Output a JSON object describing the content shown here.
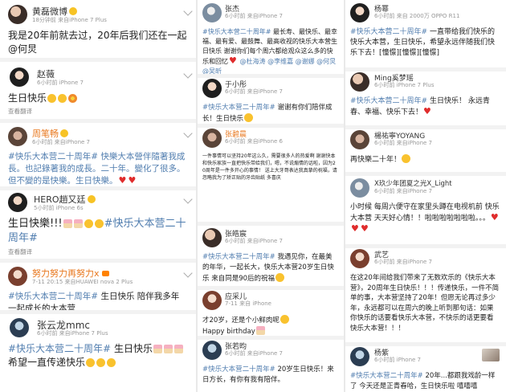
{
  "col1": {
    "posts": [
      {
        "name": "黄磊微博",
        "meta": "18分钟前  来自iPhone 7 Plus",
        "text": "我是20年前就去过，20年后我们还在一起 @何炅"
      },
      {
        "name": "赵薇",
        "meta": "6小时前    iPhone 7",
        "text": "生日快乐",
        "foot": "查看翻译"
      },
      {
        "name": "周笔畅",
        "meta": "6小时前  来自iPhone 7",
        "text": "#快乐大本营二十周年# 快樂大本營伴隨著我成長。也記錄著我的成長。二十年。變化了很多。但不變的是快樂。生日快樂。"
      },
      {
        "name": "HERO趙又廷",
        "meta": "5小时前    iPhone 6s",
        "text": "生日快樂!!!",
        "tag": "#快乐大本营二十周年#",
        "foot": "查看翻译"
      },
      {
        "name": "努力努力再努力x",
        "meta": "7-11 20:15  来自HUAWEI nova 2 Plus",
        "text_pre": "#快乐大本营二十周年#",
        "text": " 生日快乐 陪伴我多年 一起成长的大本营"
      },
      {
        "name": "张云龙mmc",
        "meta": "6小时前  来自iPhone 7 Plus",
        "tag": "#快乐大本营二十周年#",
        "text": " 生日快乐",
        "text2": "希望一直传递快乐"
      }
    ]
  },
  "col2": {
    "posts": [
      {
        "name": "张杰",
        "meta": "6小时前  来自iPhone 7",
        "tag": "#快乐大本营二十周年#",
        "text": " 最长寿、最快乐、最幸福、最有爱、最鼓舞、最高收视的快乐大本营生日快乐 谢谢你们每个周六都给观众这么多的快乐和回忆",
        "mentions": "@杜海涛 @李维嘉 @谢娜 @何炅 @吴昕"
      },
      {
        "name": "于小彤",
        "meta": "6小时前  来自iPhone 7",
        "tag": "#快乐大本营二十周年#",
        "text": " 谢谢有你们陪伴成长！生日快乐"
      },
      {
        "name": "张碧晨",
        "meta": "6小时前  来自iPhone 6",
        "text": "一件事情可以坚持20年这么久，需要很多人的热爱啊 谢谢快本和快乐家族一直把快乐带给我们，嗯，不说煽情的话啦，因为20周年是一件多开心的事情！ 送上大牙哥表达我真挚的祝福，请忽略我为了矫正贴的牙齿贴纸 多喜庆"
      },
      {
        "name": "张皓宸",
        "meta": "6小时前  来自iPhone 7",
        "tag": "#快乐大本营二十周年#",
        "text": " 我遇见你，在最美的年华，一起长大，快乐大本营20岁生日快乐 来自同是90后的祝福"
      },
      {
        "name": "应采儿",
        "meta": "7-11 来自 iPhone",
        "text": "才20岁，还是个小鲜肉呢",
        "text2": "Happy birthday"
      },
      {
        "name": "张若昀",
        "meta": "6小时前  来自iPhone 7",
        "tag": "#快乐大本营二十周年#",
        "text": " 20岁生日快乐！来日方长，有你有我有陪伴。"
      }
    ]
  },
  "col3": {
    "posts": [
      {
        "name": "杨幂",
        "meta": "6小时前  来自 2000万 OPPO R11",
        "tag": "#快乐大本营二十周年#",
        "text": " 一直带给我们快乐的快乐大本营，生日快乐，希望永远伴随我们快乐下去！[憧憬][憧憬][憧憬]"
      },
      {
        "name": "Ming",
        "name2": "奚梦瑶",
        "meta": "6小时前    iPhone 7 Plus",
        "tag": "#快乐大本营二十周年#",
        "text": " 生日快乐！ 永远青春、幸福、快乐下去！"
      },
      {
        "name": "楊祐寧YOYANG",
        "meta": "6小时前  来自iPhone 7",
        "text": "再快樂二十年！"
      },
      {
        "name": "X玖少年团夏之光X_Light",
        "meta": "6小时前  来自iPhone 7",
        "text": "小时候 每周六便守在家里头蹲在电视机前 快乐大本营 天天好心情！！啦啦啦啦啦啦啦。。。"
      },
      {
        "name": "武艺",
        "meta": "6小时前  来自iPhone 7",
        "text": "在这20年间给我们带来了无数欢乐的《快乐大本营》，20周年生日快乐！！！传递快乐，一件不简单的事，大本营坚持了20年！但愿无论再过多少年，永远都可以在周六的晚上听到那句话：如果你快乐的话要看快乐大本营，不快乐的话更要看快乐大本营！！！"
      },
      {
        "name": "杨紫",
        "meta": "6小时前    iPhone 7",
        "tag": "#快乐大本营二十周年#",
        "text": " 20年...都跟我戏龄一样了 今天还是正青春哈，生日快乐啦 嘻嘻嘻"
      }
    ]
  },
  "ui": {
    "translate": "查看翻译",
    "brand_orange": "#e8771d",
    "link_blue": "#507daf",
    "badge_yellow": "#f7c325"
  }
}
